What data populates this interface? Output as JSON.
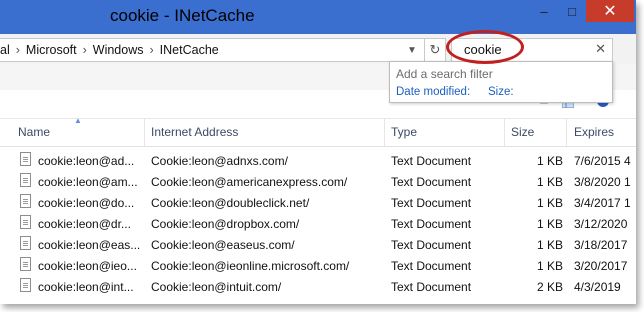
{
  "window": {
    "title": "cookie - INetCache",
    "minimize": "–",
    "maximize": "□",
    "close": "✕"
  },
  "address": {
    "segments": [
      "al",
      "Microsoft",
      "Windows",
      "INetCache"
    ],
    "dropdown_icon": "▼",
    "refresh_icon": "↻"
  },
  "search": {
    "value": "cookie",
    "clear_icon": "✕"
  },
  "filter_popup": {
    "heading": "Add a search filter",
    "date_modified": "Date modified:",
    "size": "Size:"
  },
  "columns": {
    "name": "Name",
    "internet_address": "Internet Address",
    "type": "Type",
    "size": "Size",
    "expires": "Expires"
  },
  "rows": [
    {
      "name": "cookie:leon@ad...",
      "address": "Cookie:leon@adnxs.com/",
      "type": "Text Document",
      "size": "1 KB",
      "expires": "7/6/2015 4"
    },
    {
      "name": "cookie:leon@am...",
      "address": "Cookie:leon@americanexpress.com/",
      "type": "Text Document",
      "size": "1 KB",
      "expires": "3/8/2020 1"
    },
    {
      "name": "cookie:leon@do...",
      "address": "Cookie:leon@doubleclick.net/",
      "type": "Text Document",
      "size": "1 KB",
      "expires": "3/4/2017 1"
    },
    {
      "name": "cookie:leon@dr...",
      "address": "Cookie:leon@dropbox.com/",
      "type": "Text Document",
      "size": "1 KB",
      "expires": "3/12/2020"
    },
    {
      "name": "cookie:leon@eas...",
      "address": "Cookie:leon@easeus.com/",
      "type": "Text Document",
      "size": "1 KB",
      "expires": "3/18/2017"
    },
    {
      "name": "cookie:leon@ieo...",
      "address": "Cookie:leon@ieonline.microsoft.com/",
      "type": "Text Document",
      "size": "1 KB",
      "expires": "3/20/2017"
    },
    {
      "name": "cookie:leon@int...",
      "address": "Cookie:leon@intuit.com/",
      "type": "Text Document",
      "size": "2 KB",
      "expires": "4/3/2019"
    }
  ],
  "colors": {
    "titlebar": "#3a6fd0",
    "close": "#c73b2b",
    "highlight": "#c0201f",
    "link": "#1b5fc1"
  }
}
